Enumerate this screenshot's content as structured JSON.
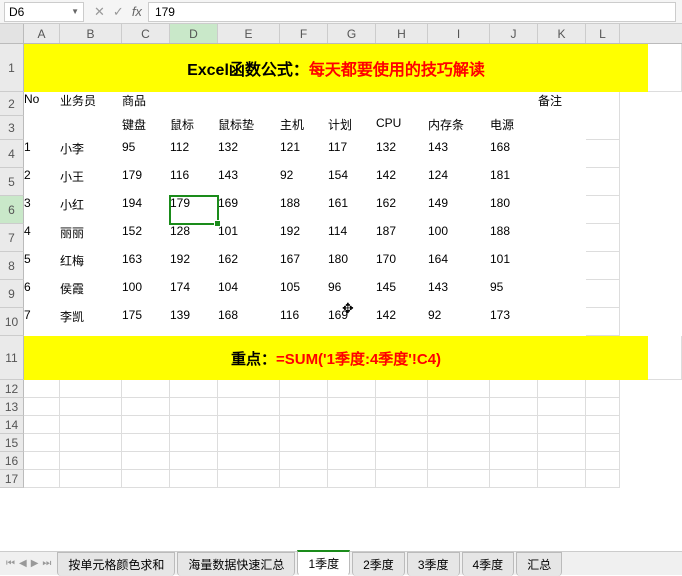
{
  "name_box": "D6",
  "formula_value": "179",
  "columns": [
    "A",
    "B",
    "C",
    "D",
    "E",
    "F",
    "G",
    "H",
    "I",
    "J",
    "K",
    "L"
  ],
  "title_black": "Excel函数公式：",
  "title_red": "每天都要使用的技巧解读",
  "header_no": "No",
  "header_sales": "业务员",
  "header_goods": "商品",
  "header_remark": "备注",
  "sub_headers": [
    "键盘",
    "鼠标",
    "鼠标垫",
    "主机",
    "计划",
    "CPU",
    "内存条",
    "电源"
  ],
  "rows": [
    {
      "no": "1",
      "name": "小李",
      "v": [
        "95",
        "112",
        "132",
        "121",
        "117",
        "132",
        "143",
        "168"
      ]
    },
    {
      "no": "2",
      "name": "小王",
      "v": [
        "179",
        "116",
        "143",
        "92",
        "154",
        "142",
        "124",
        "181"
      ]
    },
    {
      "no": "3",
      "name": "小红",
      "v": [
        "194",
        "179",
        "169",
        "188",
        "161",
        "162",
        "149",
        "180"
      ]
    },
    {
      "no": "4",
      "name": "丽丽",
      "v": [
        "152",
        "128",
        "101",
        "192",
        "114",
        "187",
        "100",
        "188"
      ]
    },
    {
      "no": "5",
      "name": "红梅",
      "v": [
        "163",
        "192",
        "162",
        "167",
        "180",
        "170",
        "164",
        "101"
      ]
    },
    {
      "no": "6",
      "name": "侯霞",
      "v": [
        "100",
        "174",
        "104",
        "105",
        "96",
        "145",
        "143",
        "95"
      ]
    },
    {
      "no": "7",
      "name": "李凯",
      "v": [
        "175",
        "139",
        "168",
        "116",
        "169",
        "142",
        "92",
        "173"
      ]
    }
  ],
  "banner2_black": "重点：",
  "banner2_red": "=SUM('1季度:4季度'!C4)",
  "tabs": [
    "按单元格颜色求和",
    "海量数据快速汇总",
    "1季度",
    "2季度",
    "3季度",
    "4季度",
    "汇总"
  ],
  "active_tab": 2,
  "active_col": "D",
  "active_row": 6
}
